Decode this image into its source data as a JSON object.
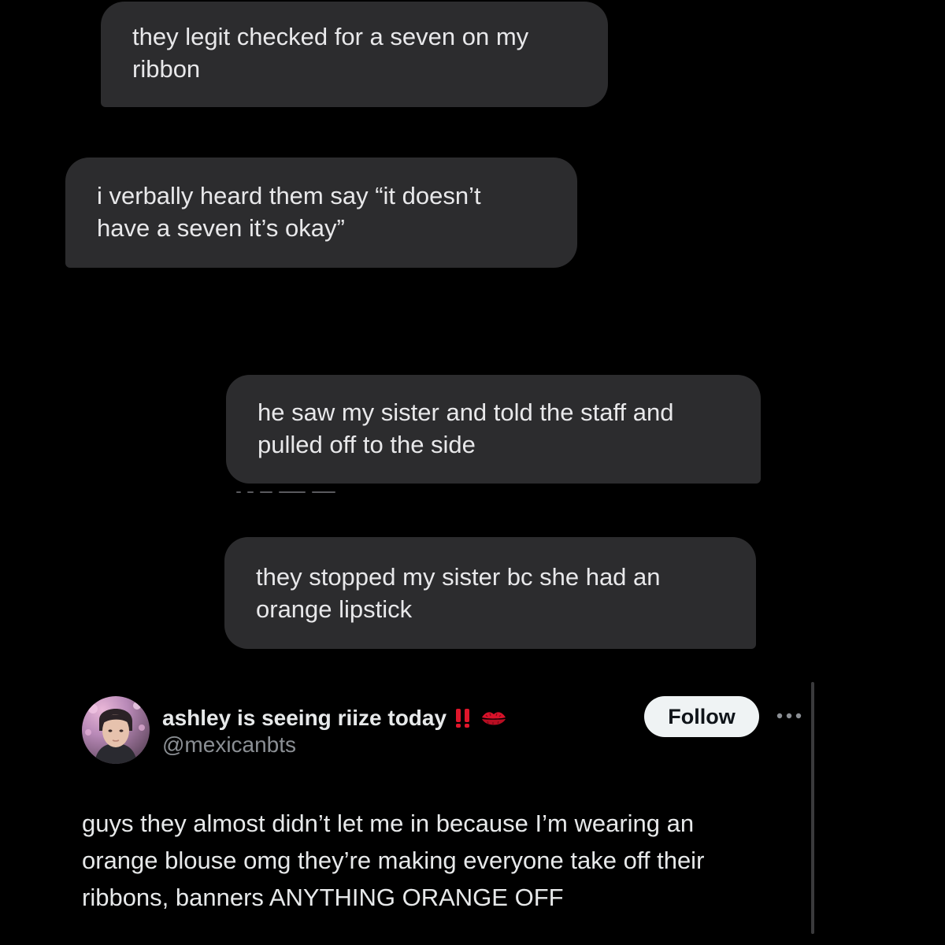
{
  "messages": [
    {
      "direction": "incoming",
      "lines": [
        "they legit checked for a seven on my",
        "ribbon"
      ]
    },
    {
      "direction": "incoming",
      "lines": [
        "i verbally heard them say “it doesn’t",
        "have a seven it’s okay”"
      ]
    },
    {
      "direction": "outgoing",
      "lines": [
        "he saw my sister and told the staff and",
        "pulled off to the side"
      ]
    },
    {
      "direction": "outgoing",
      "lines": [
        "they stopped my sister bc she had an",
        "orange lipstick"
      ]
    }
  ],
  "tweet": {
    "author": {
      "display_name": "ashley is seeing riize today",
      "name_emoji": [
        "double-exclamation-icon",
        "kiss-mark-icon"
      ],
      "handle": "@mexicanbts",
      "avatar": "profile-photo"
    },
    "follow_label": "Follow",
    "more_icon": "more-options-icon",
    "text_lines": [
      "guys they almost didn’t let me in because I’m wearing an",
      "orange blouse omg they’re making everyone take off their",
      "ribbons, banners ANYTHING ORANGE OFF"
    ]
  },
  "colors": {
    "background": "#000000",
    "bubble": "#2c2c2e",
    "bubble_text": "#e8e8ea",
    "text_primary": "#e7e9ea",
    "text_secondary": "#8b8f94",
    "follow_button_bg": "#eff3f4",
    "follow_button_text": "#0f1419",
    "emoji_red": "#e0162b"
  }
}
